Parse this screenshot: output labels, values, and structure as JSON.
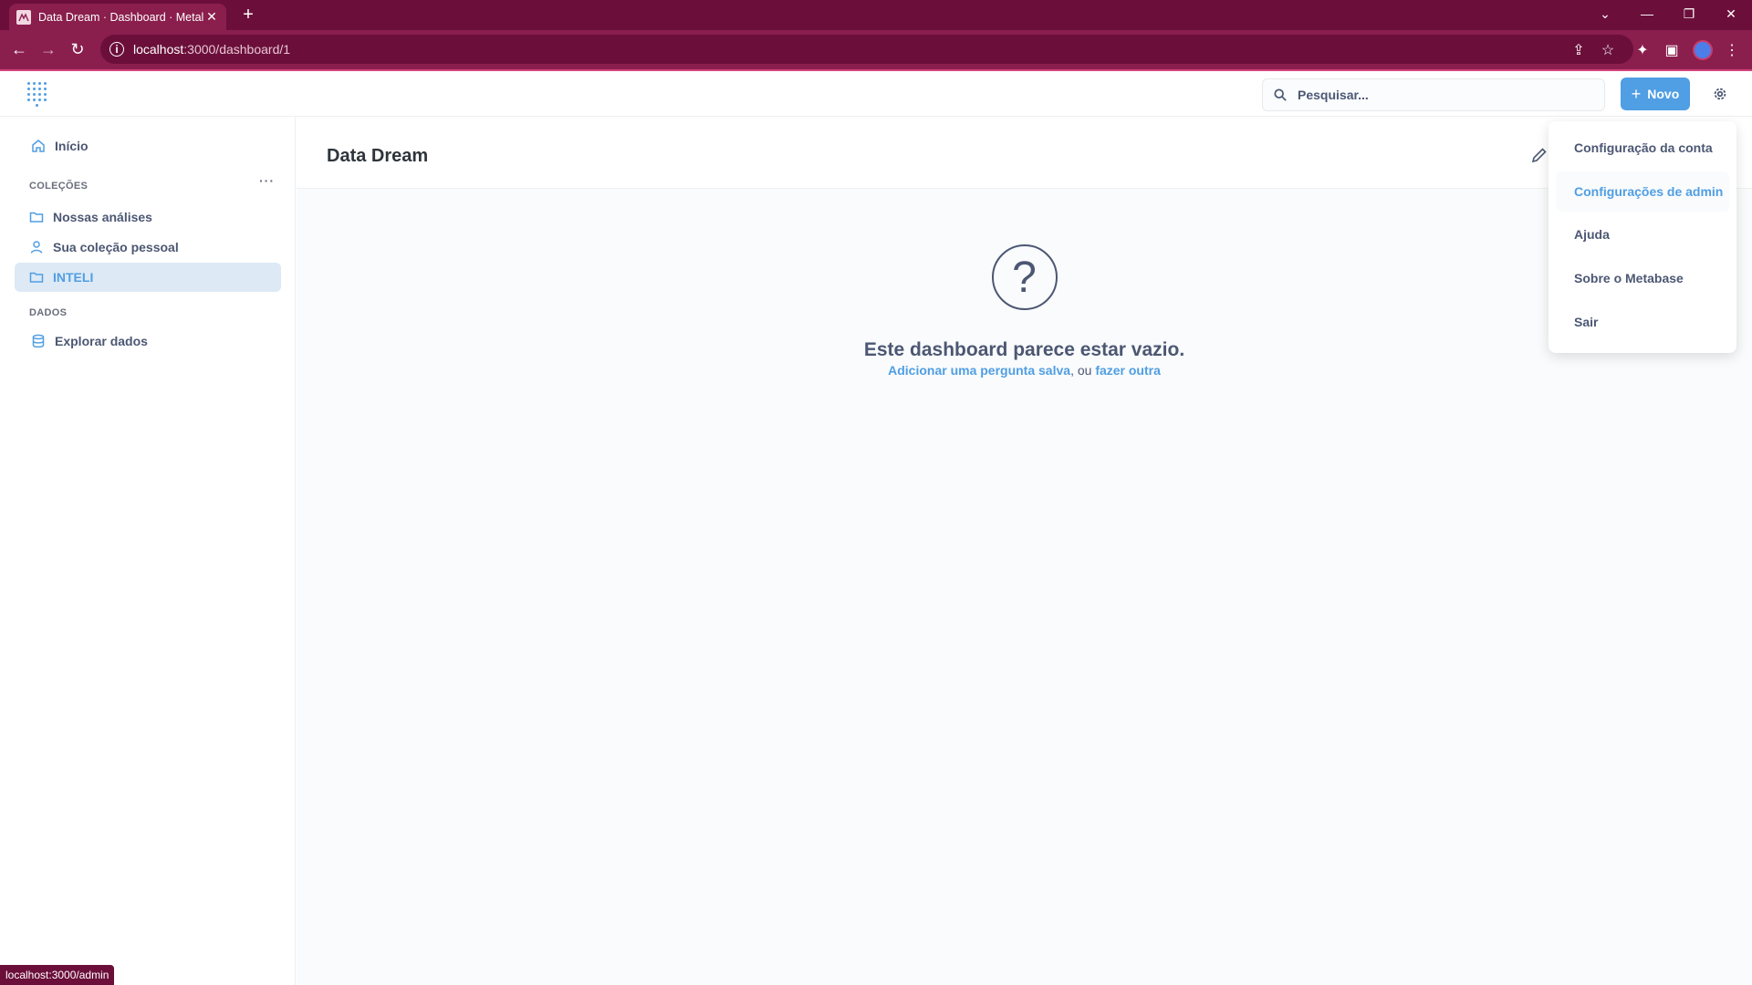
{
  "browser": {
    "tab_title": "Data Dream · Dashboard · Metal",
    "url_host": "localhost",
    "url_path": ":3000/dashboard/1",
    "status_url": "localhost:3000/admin"
  },
  "header": {
    "search_placeholder": "Pesquisar...",
    "new_button": "Novo"
  },
  "sidebar": {
    "home": "Início",
    "collections_title": "COLEÇÕES",
    "collections": [
      {
        "label": "Nossas análises"
      },
      {
        "label": "Sua coleção pessoal"
      },
      {
        "label": "INTELI"
      }
    ],
    "data_title": "DADOS",
    "browse_data": "Explorar dados"
  },
  "dashboard": {
    "title": "Data Dream",
    "empty_title": "Este dashboard parece estar vazio.",
    "empty_link1": "Adicionar uma pergunta salva",
    "empty_or": ", ou ",
    "empty_link2": "fazer outra"
  },
  "settings_menu": {
    "items": [
      {
        "label": "Configuração da conta"
      },
      {
        "label": "Configurações de admin"
      },
      {
        "label": "Ajuda"
      },
      {
        "label": "Sobre o Metabase"
      },
      {
        "label": "Sair"
      }
    ]
  },
  "colors": {
    "brand": "#509ee3",
    "chrome": "#8a1e4d",
    "chrome_dark": "#6b0f3a"
  }
}
